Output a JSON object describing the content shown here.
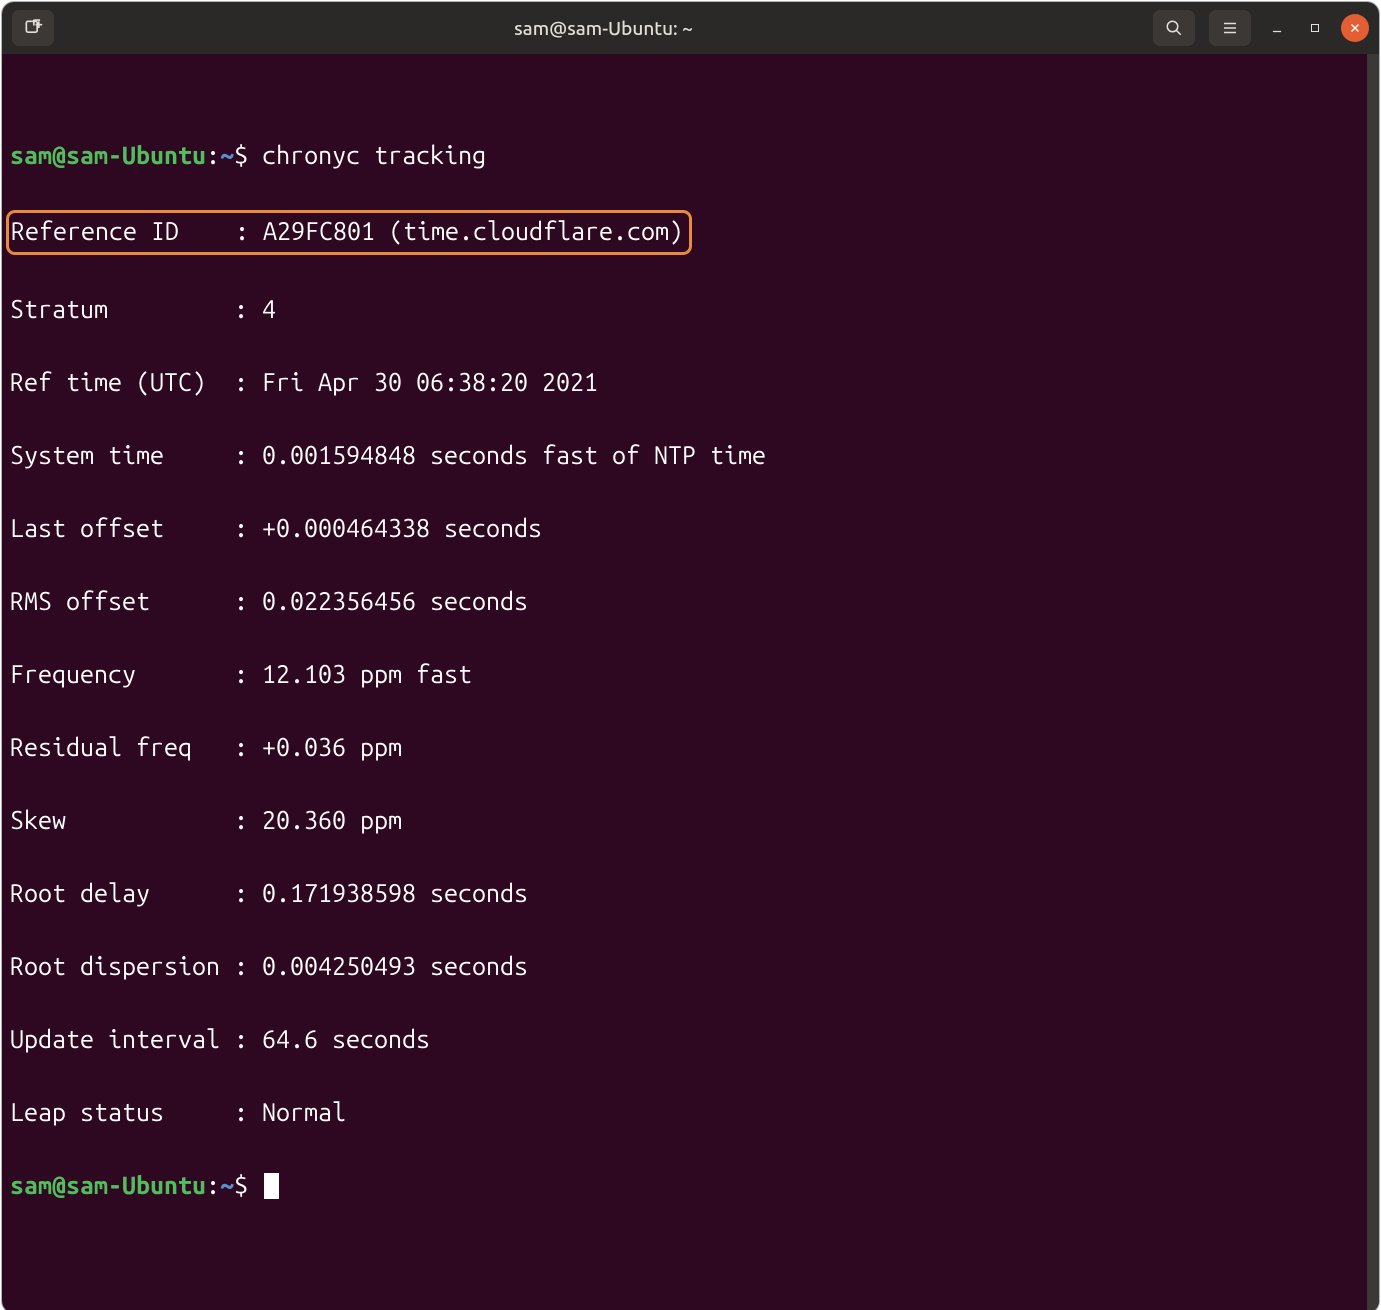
{
  "titlebar": {
    "title": "sam@sam-Ubuntu: ~"
  },
  "prompt": {
    "user": "sam",
    "at": "@",
    "host": "sam-Ubuntu",
    "colon": ":",
    "path": "~",
    "symbol": "$"
  },
  "command": "chronyc tracking",
  "output": {
    "ref_id_line": "Reference ID    : A29FC801 (time.cloudflare.com)",
    "lines": [
      "Stratum         : 4",
      "Ref time (UTC)  : Fri Apr 30 06:38:20 2021",
      "System time     : 0.001594848 seconds fast of NTP time",
      "Last offset     : +0.000464338 seconds",
      "RMS offset      : 0.022356456 seconds",
      "Frequency       : 12.103 ppm fast",
      "Residual freq   : +0.036 ppm",
      "Skew            : 20.360 ppm",
      "Root delay      : 0.171938598 seconds",
      "Root dispersion : 0.004250493 seconds",
      "Update interval : 64.6 seconds",
      "Leap status     : Normal"
    ]
  }
}
